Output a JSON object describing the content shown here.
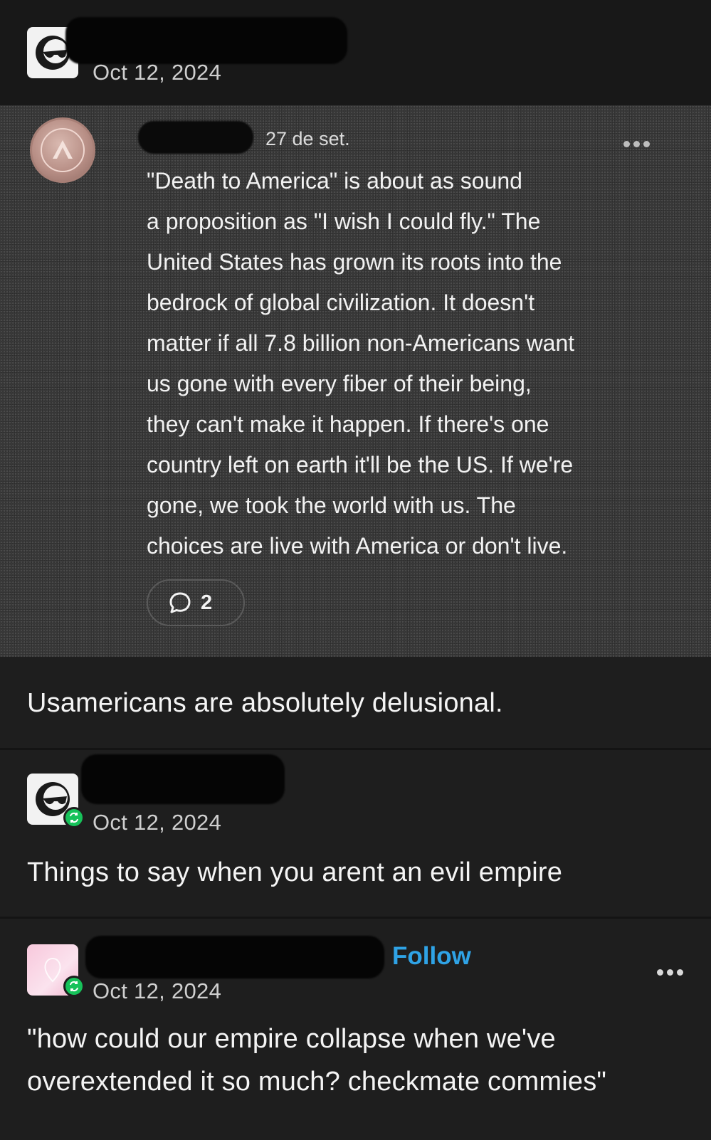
{
  "post1": {
    "date": "Oct 12, 2024",
    "avatar_icon": "sunglasses-logo-icon"
  },
  "quoted_post": {
    "date": "27 de set.",
    "avatar_icon": "spartan-coin-icon",
    "lines": [
      "\"Death to America\" is about as sound",
      "a proposition as \"I wish I could fly.\" The",
      "United States has grown its roots into the",
      "bedrock of global civilization. It doesn't",
      "matter if all 7.8 billion non-Americans want",
      "us gone with every fiber of their being,",
      "they can't make it happen. If there's one",
      "country left on earth it'll be the US. If we're",
      "gone, we took the world with us. The",
      "choices are live with America or don't live."
    ],
    "comment_count": "2"
  },
  "post1_body": "Usamericans are absolutely delusional.",
  "post2": {
    "date": "Oct 12, 2024",
    "body": "Things to say when you arent an evil empire",
    "avatar_icon": "sunglasses-logo-icon"
  },
  "post3": {
    "date": "Oct 12, 2024",
    "follow_label": "Follow",
    "body_lines": [
      "\"how could our empire collapse when we've",
      "overextended it so much? checkmate commies\""
    ],
    "avatar_icon": "pink-avatar-icon"
  },
  "colors": {
    "background": "#1e1e1e",
    "follow": "#2fa3e6",
    "reblog_badge": "#17c25a"
  }
}
